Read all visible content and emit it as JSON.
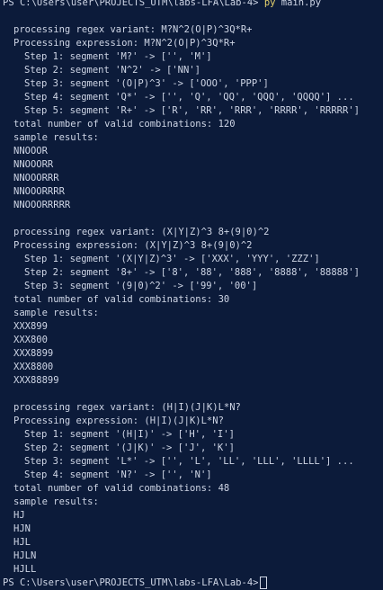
{
  "prompt": {
    "ps_path": "PS C:\\Users\\user\\PROJECTS_UTM\\labs-LFA\\Lab-4>",
    "command": "py",
    "arg": "main.py"
  },
  "blocks": [
    {
      "processing": "processing regex variant: M?N^2(O|P)^3Q*R+",
      "expression": "Processing expression: M?N^2(O|P)^3Q*R+",
      "steps": [
        "Step 1: segment 'M?' -> ['', 'M']",
        "Step 2: segment 'N^2' -> ['NN']",
        "Step 3: segment '(O|P)^3' -> ['OOO', 'PPP']",
        "Step 4: segment 'Q*' -> ['', 'Q', 'QQ', 'QQQ', 'QQQQ'] ...",
        "Step 5: segment 'R+' -> ['R', 'RR', 'RRR', 'RRRR', 'RRRRR']"
      ],
      "total": "total number of valid combinations: 120",
      "sample_label": "sample results:",
      "samples": [
        "NNOOOR",
        "NNOOORR",
        "NNOOORRR",
        "NNOOORRRR",
        "NNOOORRRRR"
      ]
    },
    {
      "processing": "processing regex variant: (X|Y|Z)^3 8+(9|0)^2",
      "expression": "Processing expression: (X|Y|Z)^3 8+(9|0)^2",
      "steps": [
        "Step 1: segment '(X|Y|Z)^3' -> ['XXX', 'YYY', 'ZZZ']",
        "Step 2: segment '8+' -> ['8', '88', '888', '8888', '88888']",
        "Step 3: segment '(9|0)^2' -> ['99', '00']"
      ],
      "total": "total number of valid combinations: 30",
      "sample_label": "sample results:",
      "samples": [
        "XXX899",
        "XXX800",
        "XXX8899",
        "XXX8800",
        "XXX88899"
      ]
    },
    {
      "processing": "processing regex variant: (H|I)(J|K)L*N?",
      "expression": "Processing expression: (H|I)(J|K)L*N?",
      "steps": [
        "Step 1: segment '(H|I)' -> ['H', 'I']",
        "Step 2: segment '(J|K)' -> ['J', 'K']",
        "Step 3: segment 'L*' -> ['', 'L', 'LL', 'LLL', 'LLLL'] ...",
        "Step 4: segment 'N?' -> ['', 'N']"
      ],
      "total": "total number of valid combinations: 48",
      "sample_label": "sample results:",
      "samples": [
        "HJ",
        "HJN",
        "HJL",
        "HJLN",
        "HJLL"
      ]
    }
  ],
  "final_prompt": "PS C:\\Users\\user\\PROJECTS_UTM\\labs-LFA\\Lab-4>"
}
